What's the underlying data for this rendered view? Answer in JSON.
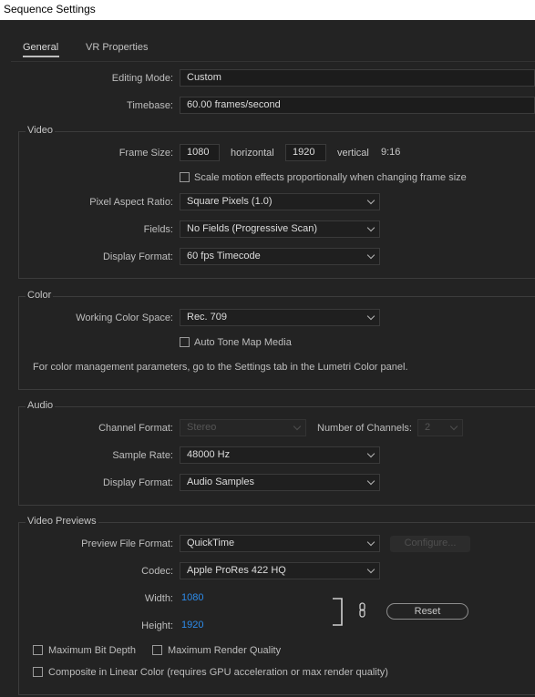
{
  "window": {
    "title": "Sequence Settings"
  },
  "tabs": [
    {
      "label": "General",
      "active": true
    },
    {
      "label": "VR Properties",
      "active": false
    }
  ],
  "general": {
    "editing_mode": {
      "label": "Editing Mode:",
      "value": "Custom"
    },
    "timebase": {
      "label": "Timebase:",
      "value": "60.00  frames/second"
    }
  },
  "video": {
    "title": "Video",
    "frame_size": {
      "label": "Frame Size:",
      "width": "1080",
      "horizontal_label": "horizontal",
      "height": "1920",
      "vertical_label": "vertical",
      "aspect": "9:16"
    },
    "scale_motion": {
      "label": "Scale motion effects proportionally when changing frame size",
      "checked": false
    },
    "pixel_aspect_ratio": {
      "label": "Pixel Aspect Ratio:",
      "value": "Square Pixels (1.0)"
    },
    "fields": {
      "label": "Fields:",
      "value": "No Fields (Progressive Scan)"
    },
    "display_format": {
      "label": "Display Format:",
      "value": "60 fps Timecode"
    }
  },
  "color": {
    "title": "Color",
    "working_color_space": {
      "label": "Working Color Space:",
      "value": "Rec. 709"
    },
    "auto_tone_map": {
      "label": "Auto Tone Map Media",
      "checked": false
    },
    "note": "For color management parameters, go to the Settings tab in the Lumetri Color panel."
  },
  "audio": {
    "title": "Audio",
    "channel_format": {
      "label": "Channel Format:",
      "value": "Stereo",
      "disabled": true
    },
    "number_of_channels": {
      "label": "Number of Channels:",
      "value": "2",
      "disabled": true
    },
    "sample_rate": {
      "label": "Sample Rate:",
      "value": "48000 Hz"
    },
    "display_format": {
      "label": "Display Format:",
      "value": "Audio Samples"
    }
  },
  "video_previews": {
    "title": "Video Previews",
    "preview_file_format": {
      "label": "Preview File Format:",
      "value": "QuickTime"
    },
    "configure_button": {
      "label": "Configure...",
      "disabled": true
    },
    "codec": {
      "label": "Codec:",
      "value": "Apple ProRes 422 HQ"
    },
    "width": {
      "label": "Width:",
      "value": "1080"
    },
    "height": {
      "label": "Height:",
      "value": "1920"
    },
    "reset_button": {
      "label": "Reset"
    },
    "maximum_bit_depth": {
      "label": "Maximum Bit Depth",
      "checked": false
    },
    "maximum_render_quality": {
      "label": "Maximum Render Quality",
      "checked": false
    },
    "composite_linear": {
      "label": "Composite in Linear Color (requires GPU acceleration or max render quality)",
      "checked": false
    }
  },
  "icons": {
    "link": "chain-link-icon",
    "bracket": "bracket-icon",
    "dropdown": "chevron-down-icon"
  },
  "colors": {
    "background": "#232323",
    "value_blue": "#2d8ceb",
    "titlebar": "#ffffff"
  }
}
